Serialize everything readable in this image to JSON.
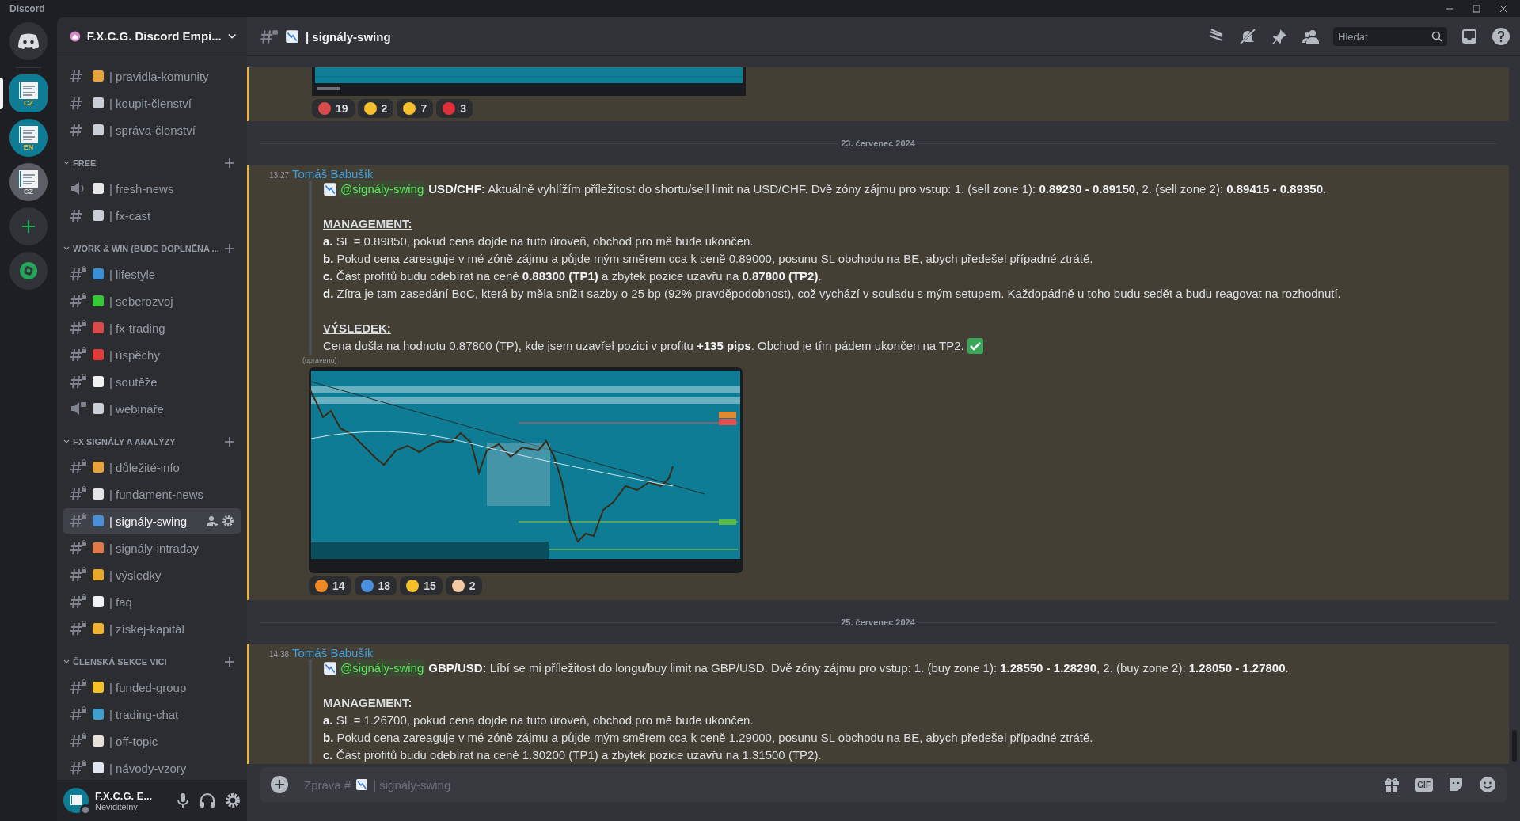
{
  "app_title": "Discord",
  "servers": [
    {
      "label": "CZ",
      "selected": true,
      "kind": "teal"
    },
    {
      "label": "EN",
      "selected": false,
      "kind": "teal"
    },
    {
      "label": "CZ",
      "selected": false,
      "kind": "grey"
    }
  ],
  "server_name": "F.X.C.G. Discord Empi...",
  "channel_groups": [
    {
      "channels": [
        {
          "name": "| pravidla-komunity",
          "kind": "text",
          "locked": false,
          "selected": false,
          "color": "#e8a33c"
        },
        {
          "name": "| koupit-členství",
          "kind": "text",
          "locked": false,
          "selected": false,
          "color": "#c9ced6"
        },
        {
          "name": "| správa-členství",
          "kind": "text",
          "locked": false,
          "selected": false,
          "color": "#c9ced6"
        }
      ]
    },
    {
      "title": "FREE",
      "channels": [
        {
          "name": "| fresh-news",
          "kind": "voice",
          "locked": false,
          "selected": false,
          "color": "#e6e6e6"
        },
        {
          "name": "| fx-cast",
          "kind": "text",
          "locked": false,
          "selected": false,
          "color": "#c9ced6"
        }
      ]
    },
    {
      "title": "WORK & WIN (BUDE DOPLNĚNA ...",
      "channels": [
        {
          "name": "| lifestyle",
          "kind": "text",
          "locked": true,
          "selected": false,
          "color": "#3a8fd8"
        },
        {
          "name": "| seberozvoj",
          "kind": "text",
          "locked": true,
          "selected": false,
          "color": "#37c837"
        },
        {
          "name": "| fx-trading",
          "kind": "text",
          "locked": true,
          "selected": false,
          "color": "#d94b4b"
        },
        {
          "name": "| úspěchy",
          "kind": "text",
          "locked": true,
          "selected": false,
          "color": "#e03a3a"
        },
        {
          "name": "| soutěže",
          "kind": "text",
          "locked": true,
          "selected": false,
          "color": "#f0f0f0"
        },
        {
          "name": "| webináře",
          "kind": "voice",
          "locked": true,
          "selected": false,
          "color": "#c9ced6"
        }
      ]
    },
    {
      "title": "FX SIGNÁLY A ANALÝZY",
      "channels": [
        {
          "name": "| důležité-info",
          "kind": "text",
          "locked": true,
          "selected": false,
          "color": "#e8a33c"
        },
        {
          "name": "| fundament-news",
          "kind": "text",
          "locked": true,
          "selected": false,
          "color": "#e6e6e6"
        },
        {
          "name": "| signály-swing",
          "kind": "text",
          "locked": true,
          "selected": true,
          "color": "#4a90d9"
        },
        {
          "name": "| signály-intraday",
          "kind": "text",
          "locked": true,
          "selected": false,
          "color": "#e07a4a"
        },
        {
          "name": "| výsledky",
          "kind": "text",
          "locked": true,
          "selected": false,
          "color": "#e8a82a"
        },
        {
          "name": "| faq",
          "kind": "text",
          "locked": true,
          "selected": false,
          "color": "#f2f3f5"
        },
        {
          "name": "| získej-kapitál",
          "kind": "text",
          "locked": true,
          "selected": false,
          "color": "#f0b232"
        }
      ]
    },
    {
      "title": "ČLENSKÁ SEKCE VICI",
      "channels": [
        {
          "name": "| funded-group",
          "kind": "text",
          "locked": true,
          "selected": false,
          "color": "#f5c02a"
        },
        {
          "name": "| trading-chat",
          "kind": "text",
          "locked": true,
          "selected": false,
          "color": "#3fa0d0"
        },
        {
          "name": "| off-topic",
          "kind": "text",
          "locked": true,
          "selected": false,
          "color": "#e8e2d8"
        },
        {
          "name": "| návody-vzory",
          "kind": "text",
          "locked": true,
          "selected": false,
          "color": "#dfe6ef"
        }
      ]
    }
  ],
  "user": {
    "name": "F.X.C.G. E...",
    "status": "Neviditelný"
  },
  "header": {
    "channel": "| signály-swing",
    "search_placeholder": "Hledat"
  },
  "feed": [
    {
      "kind": "partial",
      "reactions": [
        {
          "count": "19",
          "color": "#d94b4b"
        },
        {
          "count": "2",
          "color": "#f5c02a"
        },
        {
          "count": "7",
          "color": "#f5c02a"
        },
        {
          "count": "3",
          "color": "#e0303a"
        }
      ]
    },
    {
      "kind": "date",
      "text": "23. červenec 2024"
    },
    {
      "kind": "message",
      "time": "13:27",
      "author": "Tomáš Babušík",
      "mention": "@signály-swing",
      "lines": [
        {
          "kind": "text",
          "text": "**USD/CHF:** Aktuálně vyhlížím příležitost do shortu/sell limit na USD/CHF. Dvě zóny zájmu pro vstup: 1. (sell zone 1): **0.89230 - 0.89150**, 2. (sell zone 2): **0.89415 - 0.89350**.",
          "check": false
        },
        {
          "kind": "heading",
          "text": "MANAGEMENT:",
          "underline": true
        },
        {
          "kind": "text",
          "text": "**a.** SL = 0.89850, pokud cena dojde na tuto úroveň, obchod pro mě bude ukončen.",
          "check": false
        },
        {
          "kind": "text",
          "text": "**b.** Pokud cena zareaguje v mé zóně zájmu a půjde mým směrem cca k ceně 0.89000, posunu SL obchodu na BE, abych předešel případné ztrátě.",
          "check": false
        },
        {
          "kind": "text",
          "text": "**c.** Část profitů budu odebírat na ceně **0.88300 (TP1)** a zbytek pozice uzavřu na **0.87800 (TP2)**.",
          "check": false
        },
        {
          "kind": "text",
          "text": "**d.** Zítra je tam zasedání BoC, která by měla snížit sazby o 25 bp (92% pravděpodobnost), což vychází v souladu s mým setupem. Každopádně u toho budu sedět a budu reagovat na rozhodnutí.",
          "check": false
        },
        {
          "kind": "heading",
          "text": "VÝSLEDEK:",
          "underline": true
        },
        {
          "kind": "text",
          "text": "Cena došla na hodnotu 0.87800 (TP), kde jsem uzavřel pozici v profitu **+135 pips**. Obchod je tím pádem ukončen na TP2.",
          "check": true
        }
      ],
      "edited": "(upraveno)",
      "image": {
        "kind": "picture"
      },
      "reactions": [
        {
          "count": "14",
          "color": "#f08a24"
        },
        {
          "count": "18",
          "color": "#4a8fe0"
        },
        {
          "count": "15",
          "color": "#f5c02a"
        },
        {
          "count": "2",
          "color": "#f2c9a0"
        }
      ]
    },
    {
      "kind": "date",
      "text": "25. červenec 2024"
    },
    {
      "kind": "message",
      "time": "14:38",
      "author": "Tomáš Babušík",
      "mention": "@signály-swing",
      "lines": [
        {
          "kind": "text",
          "text": "**GBP/USD:** Líbí se mi příležitost do longu/buy limit na GBP/USD. Dvě zóny zájmu pro vstup: 1. (buy zone 1): **1.28550 - 1.28290**, 2. (buy zone 2): **1.28050 - 1.27800**.",
          "check": false
        },
        {
          "kind": "heading",
          "text": "MANAGEMENT:",
          "underline": false
        },
        {
          "kind": "text",
          "text": "**a.** SL = 1.26700, pokud cena dojde na tuto úroveň, obchod pro mě bude ukončen.",
          "check": false
        },
        {
          "kind": "text",
          "text": "**b.** Pokud cena zareaguje v mé zóně zájmu a půjde mým směrem cca k ceně 1.29000, posunu SL obchodu na BE, abych předešel případné ztrátě.",
          "check": false
        },
        {
          "kind": "text",
          "text": "**c.** Část profitů budu odebírat na ceně 1.30200 (TP1) a zbytek pozice uzavřu na 1.31500 (TP2).",
          "check": false
        }
      ]
    }
  ],
  "composer": {
    "placeholder_prefix": "Zpráva #",
    "placeholder_channel": "| signály-swing",
    "gif_label": "GIF"
  }
}
